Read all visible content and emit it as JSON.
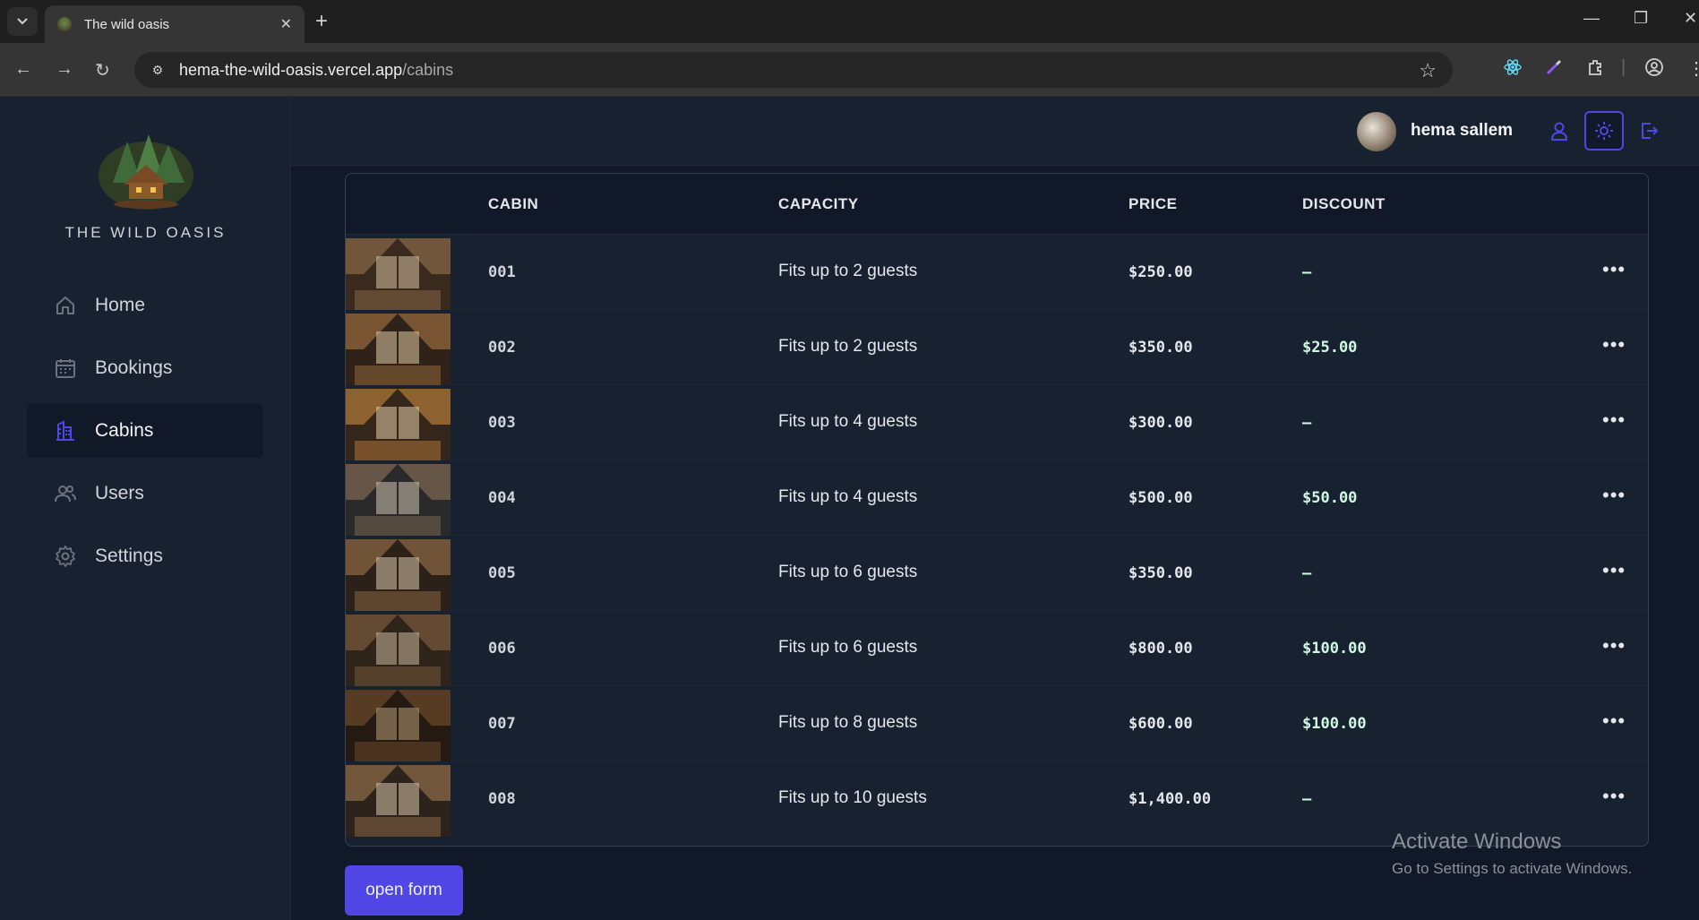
{
  "browser": {
    "tab_title": "The wild oasis",
    "url_host": "hema-the-wild-oasis.vercel.app",
    "url_path": "/cabins"
  },
  "sidebar": {
    "brand": "THE WILD OASIS",
    "items": [
      {
        "label": "Home",
        "icon": "home-icon"
      },
      {
        "label": "Bookings",
        "icon": "calendar-icon"
      },
      {
        "label": "Cabins",
        "icon": "building-icon",
        "active": true
      },
      {
        "label": "Users",
        "icon": "users-icon"
      },
      {
        "label": "Settings",
        "icon": "gear-icon"
      }
    ]
  },
  "header": {
    "username": "hema sallem"
  },
  "table": {
    "columns": [
      "CABIN",
      "CAPACITY",
      "PRICE",
      "DISCOUNT"
    ],
    "rows": [
      {
        "name": "001",
        "capacity": "Fits up to 2 guests",
        "price": "$250.00",
        "discount": "—"
      },
      {
        "name": "002",
        "capacity": "Fits up to 2 guests",
        "price": "$350.00",
        "discount": "$25.00"
      },
      {
        "name": "003",
        "capacity": "Fits up to 4 guests",
        "price": "$300.00",
        "discount": "—"
      },
      {
        "name": "004",
        "capacity": "Fits up to 4 guests",
        "price": "$500.00",
        "discount": "$50.00"
      },
      {
        "name": "005",
        "capacity": "Fits up to 6 guests",
        "price": "$350.00",
        "discount": "—"
      },
      {
        "name": "006",
        "capacity": "Fits up to 6 guests",
        "price": "$800.00",
        "discount": "$100.00"
      },
      {
        "name": "007",
        "capacity": "Fits up to 8 guests",
        "price": "$600.00",
        "discount": "$100.00"
      },
      {
        "name": "008",
        "capacity": "Fits up to 10 guests",
        "price": "$1,400.00",
        "discount": "—"
      }
    ]
  },
  "actions": {
    "open_form": "open form"
  },
  "watermark": {
    "line1": "Activate Windows",
    "line2": "Go to Settings to activate Windows."
  },
  "colors": {
    "accent": "#4f46e5",
    "sidebar_bg": "#18212f",
    "page_bg": "#111827"
  }
}
